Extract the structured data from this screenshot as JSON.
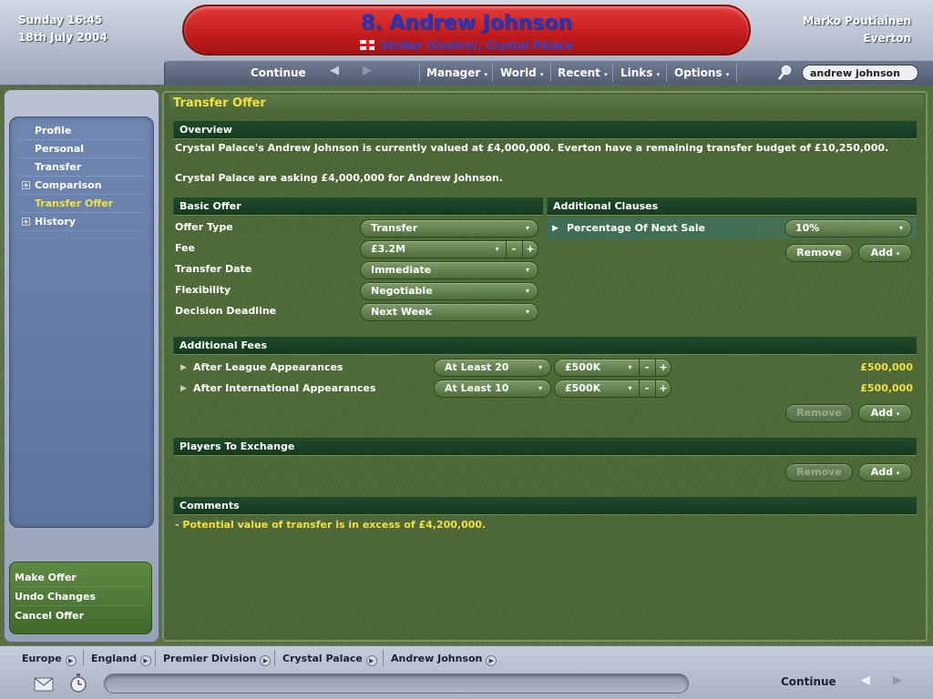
{
  "header": {
    "date_time": "Sunday 16:45",
    "date": "18th July 2004",
    "manager_name": "Marko Poutiainen",
    "club": "Everton",
    "player_title": "8. Andrew Johnson",
    "player_subtitle": "Striker (Centre), Crystal Palace"
  },
  "nav": {
    "continue": "Continue",
    "menus": [
      "Manager",
      "World",
      "Recent",
      "Links",
      "Options"
    ],
    "search_value": "andrew johnson"
  },
  "sidebar": {
    "items": [
      {
        "label": "Profile"
      },
      {
        "label": "Personal"
      },
      {
        "label": "Transfer"
      },
      {
        "label": "Comparison"
      },
      {
        "label": "Transfer Offer"
      },
      {
        "label": "History"
      }
    ],
    "actions": [
      {
        "label": "Make Offer"
      },
      {
        "label": "Undo Changes"
      },
      {
        "label": "Cancel Offer"
      }
    ]
  },
  "panel": {
    "title": "Transfer Offer",
    "overview": {
      "heading": "Overview",
      "line1": "Crystal Palace's Andrew Johnson is currently valued at £4,000,000. Everton have a remaining transfer budget of £10,250,000.",
      "line2": "Crystal Palace are asking £4,000,000 for Andrew Johnson."
    },
    "basic_offer": {
      "heading": "Basic Offer",
      "rows": [
        {
          "label": "Offer Type",
          "value": "Transfer"
        },
        {
          "label": "Fee",
          "value": "£3.2M"
        },
        {
          "label": "Transfer Date",
          "value": "Immediate"
        },
        {
          "label": "Flexibility",
          "value": "Negotiable"
        },
        {
          "label": "Decision Deadline",
          "value": "Next Week"
        }
      ]
    },
    "additional_clauses": {
      "heading": "Additional Clauses",
      "clause_label": "Percentage Of Next Sale",
      "clause_value": "10%",
      "remove": "Remove",
      "add": "Add"
    },
    "additional_fees": {
      "heading": "Additional Fees",
      "rows": [
        {
          "label": "After League Appearances",
          "condition": "At Least 20",
          "amount": "£500K",
          "total": "£500,000"
        },
        {
          "label": "After International Appearances",
          "condition": "At Least 10",
          "amount": "£500K",
          "total": "£500,000"
        }
      ],
      "remove": "Remove",
      "add": "Add"
    },
    "players_exchange": {
      "heading": "Players To Exchange",
      "remove": "Remove",
      "add": "Add"
    },
    "comments": {
      "heading": "Comments",
      "text": "- Potential value of transfer is in excess of £4,200,000."
    }
  },
  "footer": {
    "breadcrumbs": [
      "Europe",
      "England",
      "Premier Division",
      "Crystal Palace",
      "Andrew Johnson"
    ],
    "continue": "Continue"
  }
}
